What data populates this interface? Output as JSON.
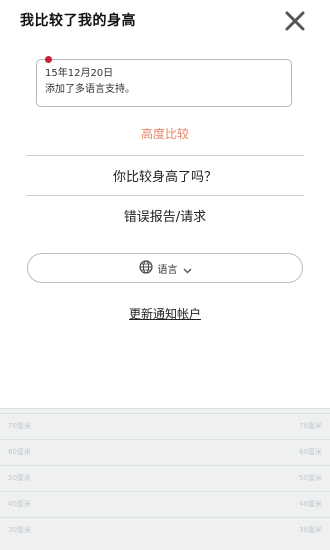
{
  "header": {
    "title": "我比较了我的身高"
  },
  "icons": {
    "close": "close-icon",
    "globe": "globe-icon",
    "chevron": "chevron-down-icon"
  },
  "news": {
    "date": "15年12月20日",
    "text": "添加了多语言支持。"
  },
  "menu": {
    "compare": "高度比较",
    "taller": "你比较身高了吗？",
    "report": "错误报告/请求"
  },
  "language": {
    "label": "语言"
  },
  "update_link": "更新通知帐户",
  "colors": {
    "accent": "#e8836a",
    "dot": "#cc1f3b",
    "background_panel": "#eef0f1"
  },
  "background_scale": [
    {
      "left": "70厘米",
      "right": "70厘米"
    },
    {
      "left": "60厘米",
      "right": "60厘米"
    },
    {
      "left": "50厘米",
      "right": "50厘米"
    },
    {
      "left": "40厘米",
      "right": "40厘米"
    },
    {
      "left": "30厘米",
      "right": "30厘米"
    }
  ]
}
